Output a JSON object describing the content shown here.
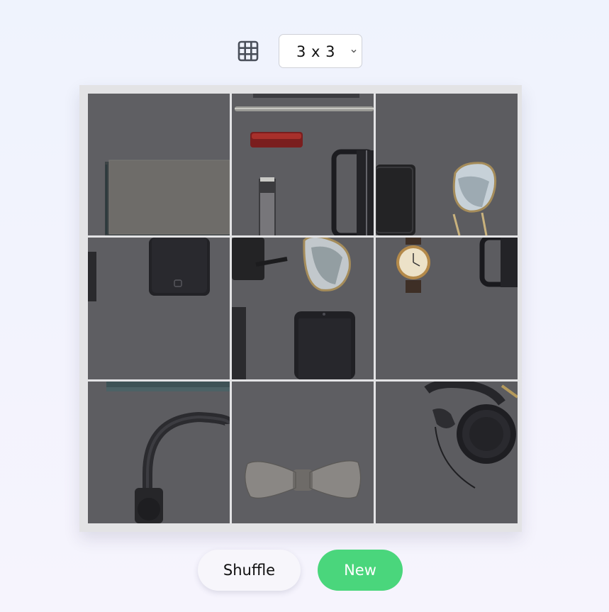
{
  "toolbar": {
    "grid_icon": "grid-icon",
    "size_selected": "3 x 3"
  },
  "puzzle": {
    "rows": 3,
    "cols": 3,
    "tiles": [
      {
        "position": 1,
        "content": "notebook corner"
      },
      {
        "position": 2,
        "content": "pen, red lipstick, watch strap, glasses"
      },
      {
        "position": 3,
        "content": "wallet and aviator sunglasses"
      },
      {
        "position": 4,
        "content": "smartphone"
      },
      {
        "position": 5,
        "content": "wallet, sunglasses and smartphone"
      },
      {
        "position": 6,
        "content": "wristwatch and glasses"
      },
      {
        "position": 7,
        "content": "headphones band"
      },
      {
        "position": 8,
        "content": "bow tie"
      },
      {
        "position": 9,
        "content": "headphones"
      }
    ]
  },
  "actions": {
    "shuffle_label": "Shuffle",
    "new_label": "New"
  },
  "colors": {
    "background": "#f0f2fd",
    "board_frame": "#e3e3e5",
    "tile_surface": "#5d5d61",
    "new_button": "#4ad67c",
    "shuffle_button": "#f7f6fb",
    "icon": "#4a4f5a"
  }
}
